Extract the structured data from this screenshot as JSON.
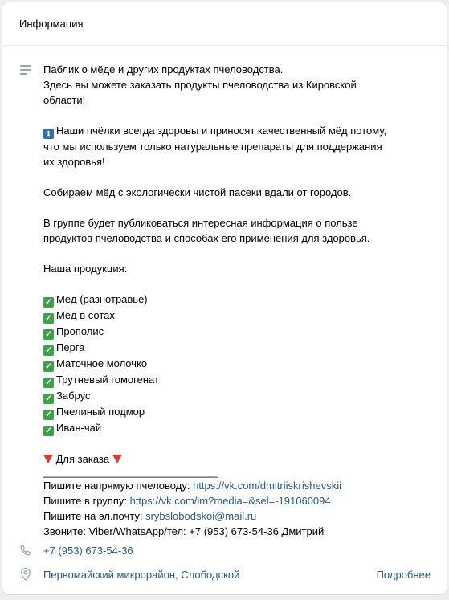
{
  "header": {
    "title": "Информация"
  },
  "description": {
    "line1": "Паблик о мёде и других продуктах пчеловодства.",
    "line2": "Здесь вы можете заказать продукты пчеловодства из Кировской",
    "line3": "области!",
    "info_badge": "ℹ",
    "line4": "Наши пчёлки всегда здоровы и приносят качественный мёд потому,",
    "line5": "что мы используем только натуральные препараты для поддержания",
    "line6": "их здоровья!",
    "line7": "Собираем мёд с экологически чистой пасеки вдали от городов.",
    "line8": "В группе будет публиковаться интересная информация о пользе",
    "line9": "продуктов пчеловодства и способах его применения для здоровья.",
    "products_title": "Наша продукция:",
    "products": [
      "Мёд (разнотравье)",
      "Мёд в сотах",
      "Прополис",
      "Перга",
      "Маточное молочко",
      "Трутневый гомогенат",
      "Забрус",
      "Пчелиный подмор",
      "Иван-чай"
    ],
    "order_title": "Для заказа",
    "separator": "______________________________",
    "contact_beekeeper_label": "Пишите напрямую пчеловоду: ",
    "contact_beekeeper_link": "https://vk.com/dmitriiskrishevskii",
    "contact_group_label": "Пишите в группу: ",
    "contact_group_link": "https://vk.com/im?media=&sel=-191060094",
    "contact_email_label": "Пишите на эл.почту: ",
    "contact_email_link": "srybslobodskoi@mail.ru",
    "contact_call": "Звоните: Viber/WhatsApp/тел: +7 (953) 673-54-36 Дмитрий"
  },
  "phone": "+7 (953) 673-54-36",
  "address": "Первомайский микрорайон, Слободской",
  "more_label": "Подробнее",
  "colors": {
    "link": "#2a5885",
    "icon": "#99a2ad",
    "check": "#3aa24a",
    "triangle": "#d9382c"
  }
}
